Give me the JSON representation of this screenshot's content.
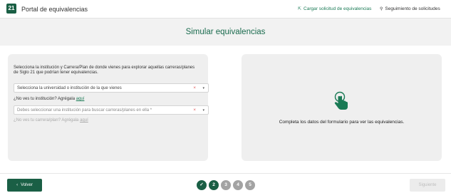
{
  "header": {
    "logo_text": "21",
    "app_title": "Portal de equivalencias",
    "nav_upload": "Cargar solicitud de equivalencias",
    "nav_track": "Seguimiento de solicitudes"
  },
  "page": {
    "title": "Simular equivalencias"
  },
  "form": {
    "intro": "Selecciona la institución y Carrera/Plan de donde vienes para explorar aquellas carreras/planes de Siglo 21 que podrían tener equivalencias.",
    "institution_placeholder": "Selecciona la universidad o institución de la que vienes",
    "institution_hint": "¿No ves tu institución? Agrégala",
    "institution_hint_link": "aquí",
    "career_placeholder": "Debes seleccionar una institución para buscar carreras/planes en ella *",
    "career_hint": "¿No ves tu carrera/plan? Agrégala",
    "career_hint_link": "aquí",
    "clear_glyph": "×",
    "caret_glyph": "▾"
  },
  "result": {
    "message": "Completa los datos del formulario para ver las equivalencias."
  },
  "footer": {
    "back_label": "Volver",
    "next_label": "Siguiente",
    "steps": [
      {
        "label": "✓",
        "state": "done"
      },
      {
        "label": "2",
        "state": "current"
      },
      {
        "label": "3",
        "state": "pending"
      },
      {
        "label": "4",
        "state": "pending"
      },
      {
        "label": "5",
        "state": "pending"
      }
    ]
  },
  "colors": {
    "brand": "#1a5f45",
    "link": "#1a7a55",
    "clear": "#e05a5a"
  },
  "icons": {
    "upload": "upload-icon",
    "search": "search-icon",
    "pointer": "hand-pointer-icon",
    "back": "chevron-left-icon"
  }
}
